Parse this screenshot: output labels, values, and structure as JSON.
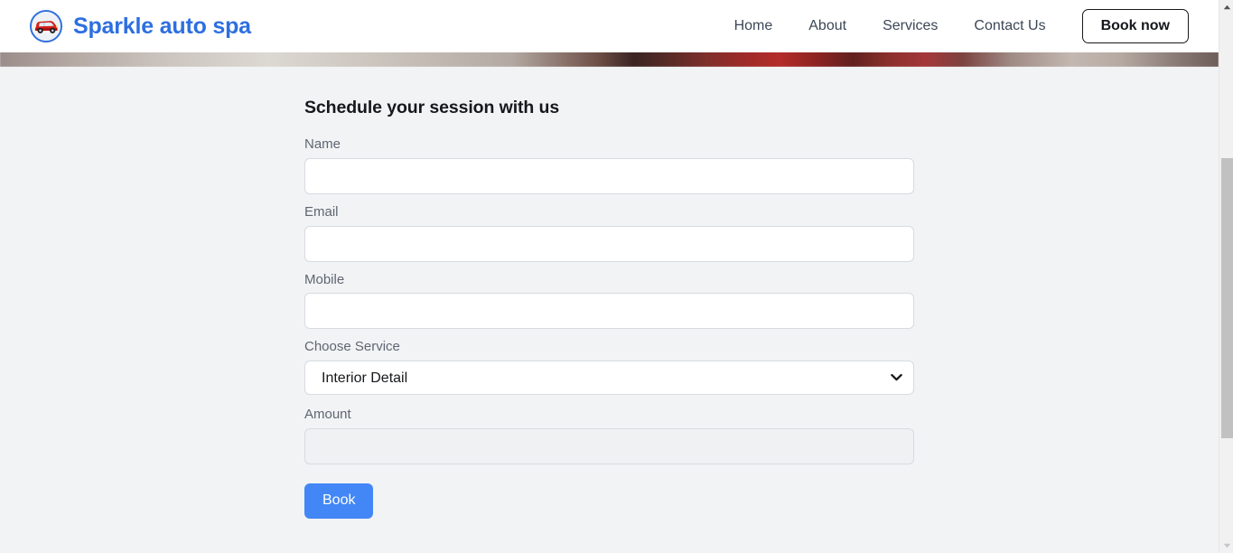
{
  "header": {
    "brand": {
      "logo_icon": "red-car-circle-logo",
      "name": "Sparkle auto spa",
      "name_color": "#2d6fe0"
    },
    "nav": [
      {
        "label": "Home"
      },
      {
        "label": "About"
      },
      {
        "label": "Services"
      },
      {
        "label": "Contact Us"
      }
    ],
    "cta": {
      "label": "Book now"
    }
  },
  "hero": {
    "alt": "car-wash-hero-image-strip"
  },
  "form": {
    "title": "Schedule your session with us",
    "fields": {
      "name": {
        "label": "Name",
        "value": "",
        "placeholder": ""
      },
      "email": {
        "label": "Email",
        "value": "",
        "placeholder": ""
      },
      "mobile": {
        "label": "Mobile",
        "value": "",
        "placeholder": ""
      },
      "service": {
        "label": "Choose Service",
        "selected": "Interior Detail",
        "options": [
          "Interior Detail"
        ],
        "chevron_icon": "chevron-down-icon"
      },
      "amount": {
        "label": "Amount",
        "value": "",
        "placeholder": "",
        "disabled": true
      }
    },
    "submit": {
      "label": "Book",
      "color": "#4287f5"
    }
  },
  "scrollbar": {
    "up_arrow_icon": "scroll-up-arrow-icon",
    "down_arrow_icon": "scroll-down-arrow-icon"
  }
}
